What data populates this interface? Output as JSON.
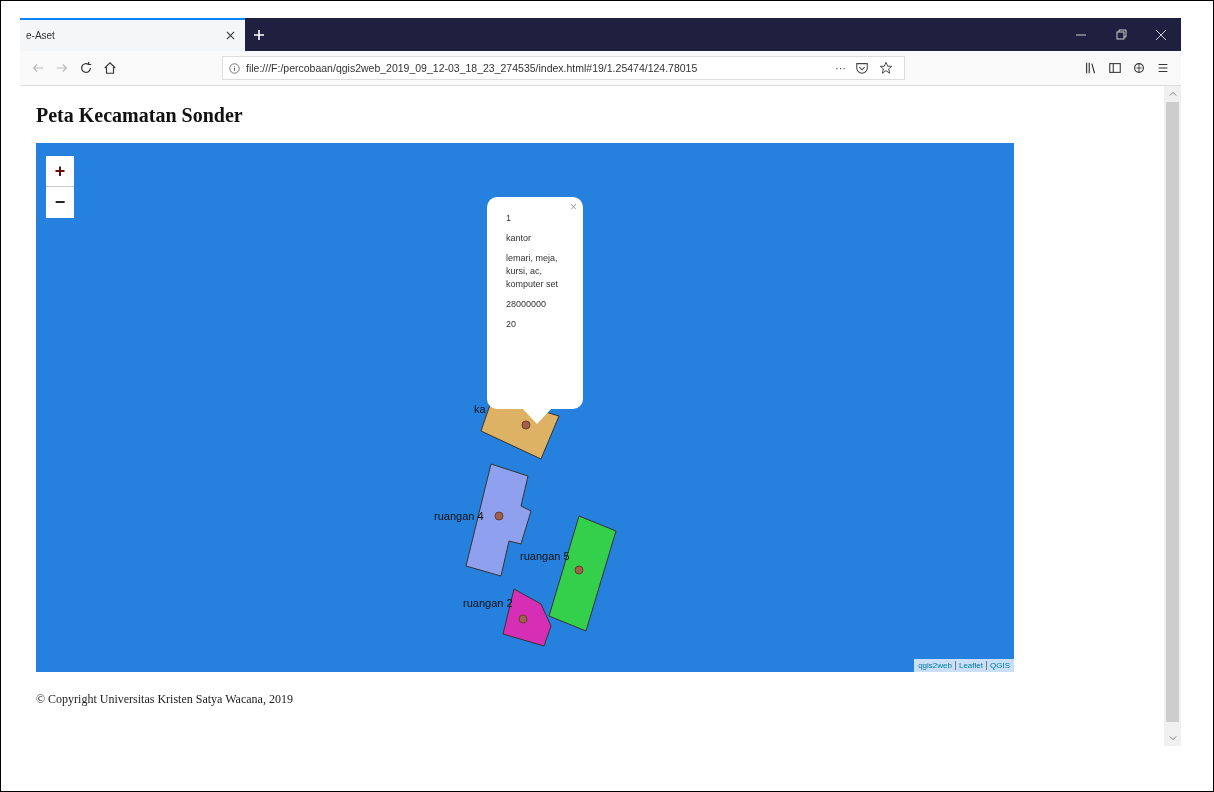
{
  "browser": {
    "tab": {
      "title": "e-Aset",
      "selected": true
    },
    "address": "file:///F:/percobaan/qgis2web_2019_09_12-03_18_23_274535/index.html#19/1.25474/124.78015",
    "toolbar_more": "···"
  },
  "page": {
    "title": "Peta Kecamatan Sonder",
    "map": {
      "zoom_in": "+",
      "zoom_out": "−",
      "features": [
        {
          "label": "ka",
          "color": "#deb264"
        },
        {
          "label": "ruangan 4",
          "color": "#8fa0ee"
        },
        {
          "label": "ruangan 5",
          "color": "#34d04c"
        },
        {
          "label": "ruangan 2",
          "color": "#d62fb6"
        }
      ],
      "popup": {
        "close": "×",
        "lines": [
          "1",
          "kantor",
          "lemari, meja, kursi, ac, komputer set",
          "28000000",
          "20"
        ]
      },
      "attribution": [
        "qgis2web",
        "Leaflet",
        "QGIS"
      ]
    },
    "footer": "© Copyright Universitas Kristen Satya Wacana, 2019"
  }
}
